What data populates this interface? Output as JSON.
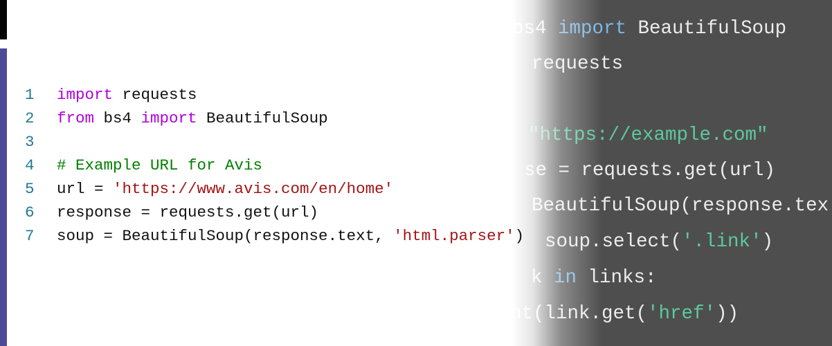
{
  "colors": {
    "keyword": "#af00db",
    "string": "#a31515",
    "comment": "#008000",
    "plain": "#111111",
    "line_number": "#237893",
    "dark_bg": "#4e4e4e",
    "dark_plain": "#ececec",
    "dark_keyword": "#7ab6e6",
    "dark_string": "#5cc9a0",
    "accent_bar": "#4f4a98"
  },
  "editor": {
    "lines": [
      {
        "num": "1",
        "tokens": [
          {
            "t": "import",
            "k": "keyword"
          },
          {
            "t": " requests",
            "k": "plain"
          }
        ]
      },
      {
        "num": "2",
        "tokens": [
          {
            "t": "from",
            "k": "keyword"
          },
          {
            "t": " bs4 ",
            "k": "plain"
          },
          {
            "t": "import",
            "k": "keyword"
          },
          {
            "t": " BeautifulSoup",
            "k": "plain"
          }
        ]
      },
      {
        "num": "3",
        "tokens": []
      },
      {
        "num": "4",
        "tokens": [
          {
            "t": "# Example URL for Avis",
            "k": "comment"
          }
        ]
      },
      {
        "num": "5",
        "tokens": [
          {
            "t": "url = ",
            "k": "plain"
          },
          {
            "t": "'https://www.avis.com/en/home'",
            "k": "string"
          }
        ]
      },
      {
        "num": "6",
        "tokens": [
          {
            "t": "response = requests.get(url)",
            "k": "plain"
          }
        ]
      },
      {
        "num": "7",
        "tokens": [
          {
            "t": "soup = BeautifulSoup(response.text, ",
            "k": "plain"
          },
          {
            "t": "'html.parser'",
            "k": "string"
          },
          {
            "t": ")",
            "k": "plain"
          }
        ]
      }
    ]
  },
  "background_code": {
    "lines": [
      {
        "tokens": [
          {
            "t": "bs4 ",
            "k": "dark_plain"
          },
          {
            "t": "import",
            "k": "dark_keyword"
          },
          {
            "t": " BeautifulSoup",
            "k": "dark_plain"
          }
        ]
      },
      {
        "tokens": [
          {
            "t": "requests",
            "k": "dark_plain"
          }
        ]
      },
      {
        "tokens": []
      },
      {
        "tokens": [
          {
            "t": "\"https://example.com\"",
            "k": "dark_string"
          }
        ]
      },
      {
        "tokens": [
          {
            "t": "se = requests.get(url)",
            "k": "dark_plain"
          }
        ]
      },
      {
        "tokens": [
          {
            "t": "BeautifulSoup(response.tex",
            "k": "dark_plain"
          }
        ]
      },
      {
        "tokens": [
          {
            "t": "soup.select(",
            "k": "dark_plain"
          },
          {
            "t": "'.link'",
            "k": "dark_string"
          },
          {
            "t": ")",
            "k": "dark_plain"
          }
        ]
      },
      {
        "tokens": [
          {
            "t": "k ",
            "k": "dark_plain"
          },
          {
            "t": "in",
            "k": "dark_keyword"
          },
          {
            "t": " links:",
            "k": "dark_plain"
          }
        ]
      },
      {
        "tokens": [
          {
            "t": "nt(link.get(",
            "k": "dark_plain"
          },
          {
            "t": "'href'",
            "k": "dark_string"
          },
          {
            "t": "))",
            "k": "dark_plain"
          }
        ]
      }
    ]
  }
}
